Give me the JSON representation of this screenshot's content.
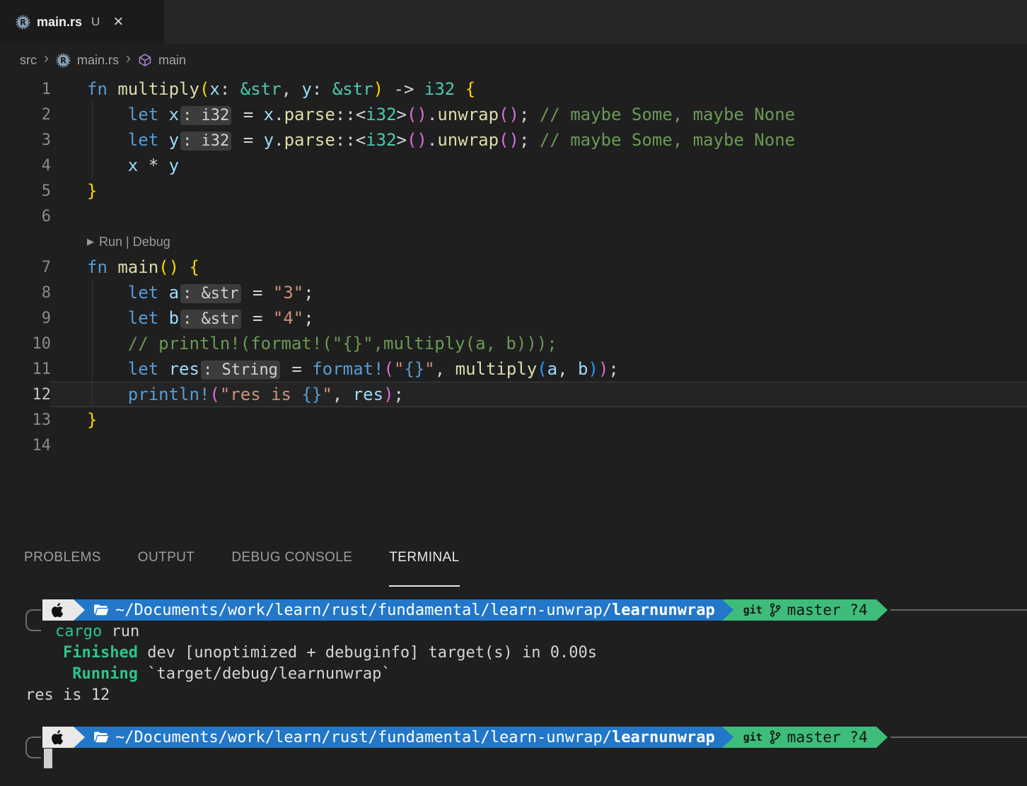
{
  "tab": {
    "title": "main.rs",
    "dirty": "U",
    "close": "×"
  },
  "breadcrumb": {
    "items": [
      "src",
      "main.rs",
      "main"
    ],
    "separator": "›"
  },
  "editor": {
    "code_lens": "Run | Debug",
    "lens_play": "▶",
    "lines": [
      {
        "num": "1",
        "tokens": [
          [
            "k",
            "fn"
          ],
          [
            "p",
            " "
          ],
          [
            "f",
            "multiply"
          ],
          [
            "b1",
            "("
          ],
          [
            "v",
            "x"
          ],
          [
            "p",
            ": "
          ],
          [
            "ty",
            "&str"
          ],
          [
            "p",
            ", "
          ],
          [
            "v",
            "y"
          ],
          [
            "p",
            ": "
          ],
          [
            "ty",
            "&str"
          ],
          [
            "b1",
            ")"
          ],
          [
            "p",
            " -> "
          ],
          [
            "ty",
            "i32"
          ],
          [
            "p",
            " "
          ],
          [
            "b1",
            "{"
          ]
        ]
      },
      {
        "num": "2",
        "tokens": [
          [
            "p",
            "    "
          ],
          [
            "k",
            "let"
          ],
          [
            "p",
            " "
          ],
          [
            "v",
            "x"
          ],
          [
            "hint",
            ": i32"
          ],
          [
            "p",
            " = "
          ],
          [
            "v",
            "x"
          ],
          [
            "p",
            "."
          ],
          [
            "f",
            "parse"
          ],
          [
            "p",
            "::<"
          ],
          [
            "ty",
            "i32"
          ],
          [
            "p",
            ">"
          ],
          [
            "b2",
            "()"
          ],
          [
            "p",
            "."
          ],
          [
            "f",
            "unwrap"
          ],
          [
            "b2",
            "()"
          ],
          [
            "p",
            "; "
          ],
          [
            "c",
            "// maybe Some, maybe None"
          ]
        ]
      },
      {
        "num": "3",
        "tokens": [
          [
            "p",
            "    "
          ],
          [
            "k",
            "let"
          ],
          [
            "p",
            " "
          ],
          [
            "v",
            "y"
          ],
          [
            "hint",
            ": i32"
          ],
          [
            "p",
            " = "
          ],
          [
            "v",
            "y"
          ],
          [
            "p",
            "."
          ],
          [
            "f",
            "parse"
          ],
          [
            "p",
            "::<"
          ],
          [
            "ty",
            "i32"
          ],
          [
            "p",
            ">"
          ],
          [
            "b2",
            "()"
          ],
          [
            "p",
            "."
          ],
          [
            "f",
            "unwrap"
          ],
          [
            "b2",
            "()"
          ],
          [
            "p",
            "; "
          ],
          [
            "c",
            "// maybe Some, maybe None"
          ]
        ]
      },
      {
        "num": "4",
        "tokens": [
          [
            "p",
            "    "
          ],
          [
            "v",
            "x"
          ],
          [
            "p",
            " * "
          ],
          [
            "v",
            "y"
          ]
        ]
      },
      {
        "num": "5",
        "tokens": [
          [
            "b1",
            "}"
          ]
        ]
      },
      {
        "num": "6",
        "tokens": []
      },
      {
        "lens": true
      },
      {
        "num": "7",
        "tokens": [
          [
            "k",
            "fn"
          ],
          [
            "p",
            " "
          ],
          [
            "f",
            "main"
          ],
          [
            "b1",
            "()"
          ],
          [
            "p",
            " "
          ],
          [
            "b1",
            "{"
          ]
        ]
      },
      {
        "num": "8",
        "tokens": [
          [
            "p",
            "    "
          ],
          [
            "k",
            "let"
          ],
          [
            "p",
            " "
          ],
          [
            "v",
            "a"
          ],
          [
            "hint",
            ": &str"
          ],
          [
            "p",
            " = "
          ],
          [
            "s",
            "\"3\""
          ],
          [
            "p",
            ";"
          ]
        ]
      },
      {
        "num": "9",
        "tokens": [
          [
            "p",
            "    "
          ],
          [
            "k",
            "let"
          ],
          [
            "p",
            " "
          ],
          [
            "v",
            "b"
          ],
          [
            "hint",
            ": &str"
          ],
          [
            "p",
            " = "
          ],
          [
            "s",
            "\"4\""
          ],
          [
            "p",
            ";"
          ]
        ]
      },
      {
        "num": "10",
        "tokens": [
          [
            "p",
            "    "
          ],
          [
            "c",
            "// println!(format!(\"{}\",multiply(a, b)));"
          ]
        ]
      },
      {
        "num": "11",
        "tokens": [
          [
            "p",
            "    "
          ],
          [
            "k",
            "let"
          ],
          [
            "p",
            " "
          ],
          [
            "v",
            "res"
          ],
          [
            "hint",
            ": String"
          ],
          [
            "p",
            " = "
          ],
          [
            "m",
            "format!"
          ],
          [
            "b2",
            "("
          ],
          [
            "s",
            "\""
          ],
          [
            "fs",
            "{}"
          ],
          [
            "s",
            "\""
          ],
          [
            "p",
            ", "
          ],
          [
            "f",
            "multiply"
          ],
          [
            "b3",
            "("
          ],
          [
            "v",
            "a"
          ],
          [
            "p",
            ", "
          ],
          [
            "v",
            "b"
          ],
          [
            "b3",
            ")"
          ],
          [
            "b2",
            ")"
          ],
          [
            "p",
            ";"
          ]
        ]
      },
      {
        "num": "12",
        "current": true,
        "tokens": [
          [
            "p",
            "    "
          ],
          [
            "m",
            "println!"
          ],
          [
            "b2",
            "("
          ],
          [
            "s",
            "\"res is "
          ],
          [
            "fs",
            "{}"
          ],
          [
            "s",
            "\""
          ],
          [
            "p",
            ", "
          ],
          [
            "v",
            "res"
          ],
          [
            "b2",
            ")"
          ],
          [
            "p",
            ";"
          ]
        ]
      },
      {
        "num": "13",
        "tokens": [
          [
            "b1",
            "}"
          ]
        ]
      },
      {
        "num": "14",
        "tokens": []
      }
    ]
  },
  "panel": {
    "tabs": [
      {
        "label": "PROBLEMS",
        "active": false
      },
      {
        "label": "OUTPUT",
        "active": false
      },
      {
        "label": "DEBUG CONSOLE",
        "active": false
      },
      {
        "label": "TERMINAL",
        "active": true
      }
    ]
  },
  "terminal": {
    "prompt": {
      "path_prefix": "~/Documents/work/learn/rust/fundamental/learn-unwrap/",
      "path_bold": "learnunwrap",
      "git_label": "git",
      "branch": "master ?4"
    },
    "blocks": [
      {
        "type": "prompt"
      },
      {
        "type": "cmd",
        "tokens": [
          [
            "tg",
            "cargo"
          ],
          [
            "tw",
            " run"
          ]
        ]
      },
      {
        "type": "out",
        "tokens": [
          [
            "tw",
            "    "
          ],
          [
            "tgb",
            "Finished"
          ],
          [
            "tw",
            " dev [unoptimized + debuginfo] target(s) in 0.00s"
          ]
        ]
      },
      {
        "type": "out",
        "tokens": [
          [
            "tw",
            "     "
          ],
          [
            "tgb",
            "Running"
          ],
          [
            "tw",
            " `target/debug/learnunwrap`"
          ]
        ]
      },
      {
        "type": "out",
        "tokens": [
          [
            "tw",
            "res is 12"
          ]
        ]
      },
      {
        "type": "blank"
      },
      {
        "type": "prompt"
      },
      {
        "type": "cursor"
      }
    ]
  },
  "icons": {
    "rust": "rust-gear-logo",
    "cube": "symbol-module-cube",
    "apple": "apple-logo",
    "folder": "open-folder",
    "branch": "git-branch"
  },
  "colors": {
    "prompt_blue": "#2277c8",
    "prompt_green": "#3ebc7a",
    "terminal_green": "#2dc489",
    "accent_purple": "#b180d7"
  }
}
